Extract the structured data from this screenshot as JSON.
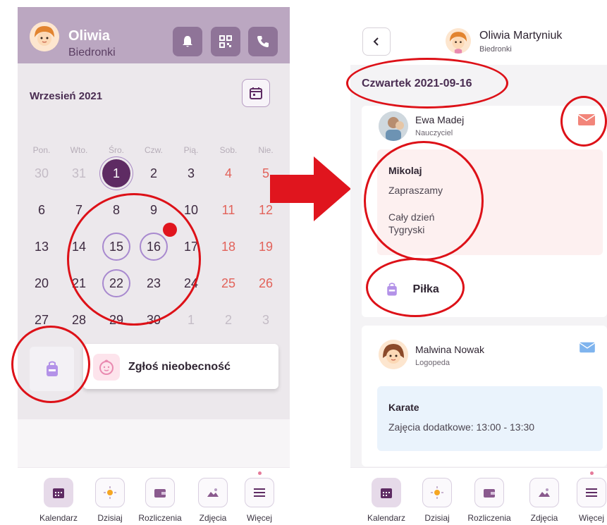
{
  "left": {
    "header": {
      "name": "Oliwia",
      "group": "Biedronki"
    },
    "month": "Wrzesień 2021",
    "weekdays": [
      "Pon.",
      "Wto.",
      "Śro.",
      "Czw.",
      "Pią.",
      "Sob.",
      "Nie."
    ],
    "weeks": [
      [
        "30",
        "31",
        "1",
        "2",
        "3",
        "4",
        "5"
      ],
      [
        "6",
        "7",
        "8",
        "9",
        "10",
        "11",
        "12"
      ],
      [
        "13",
        "14",
        "15",
        "16",
        "17",
        "18",
        "19"
      ],
      [
        "20",
        "21",
        "22",
        "23",
        "24",
        "25",
        "26"
      ],
      [
        "27",
        "28",
        "29",
        "30",
        "1",
        "2",
        "3"
      ]
    ],
    "absence_label": "Zgłoś nieobecność"
  },
  "nav": {
    "items": [
      "Kalendarz",
      "Dzisiaj",
      "Rozliczenia",
      "Zdjęcia",
      "Więcej"
    ],
    "active": "Kalendarz"
  },
  "right": {
    "header": {
      "name": "Oliwia Martyniuk",
      "group": "Biedronki"
    },
    "date": "Czwartek 2021-09-16",
    "teacher": {
      "name": "Ewa Madej",
      "role": "Nauczyciel"
    },
    "event": {
      "title": "Mikolaj",
      "line1": "Zapraszamy",
      "line2": "Cały dzień",
      "line3": "Tygryski"
    },
    "item": "Piłka",
    "therapist": {
      "name": "Malwina Nowak",
      "role": "Logopeda"
    },
    "activity": {
      "title": "Karate",
      "detail": "Zajęcia dodatkowe: 13:00 - 13:30"
    }
  },
  "colors": {
    "header": "#bba7c1",
    "accent": "#5e2b63",
    "weekend": "#e2625a",
    "annotation": "#dd1118",
    "event_bg": "#fdf0f0",
    "activity_bg": "#eaf3fc"
  }
}
